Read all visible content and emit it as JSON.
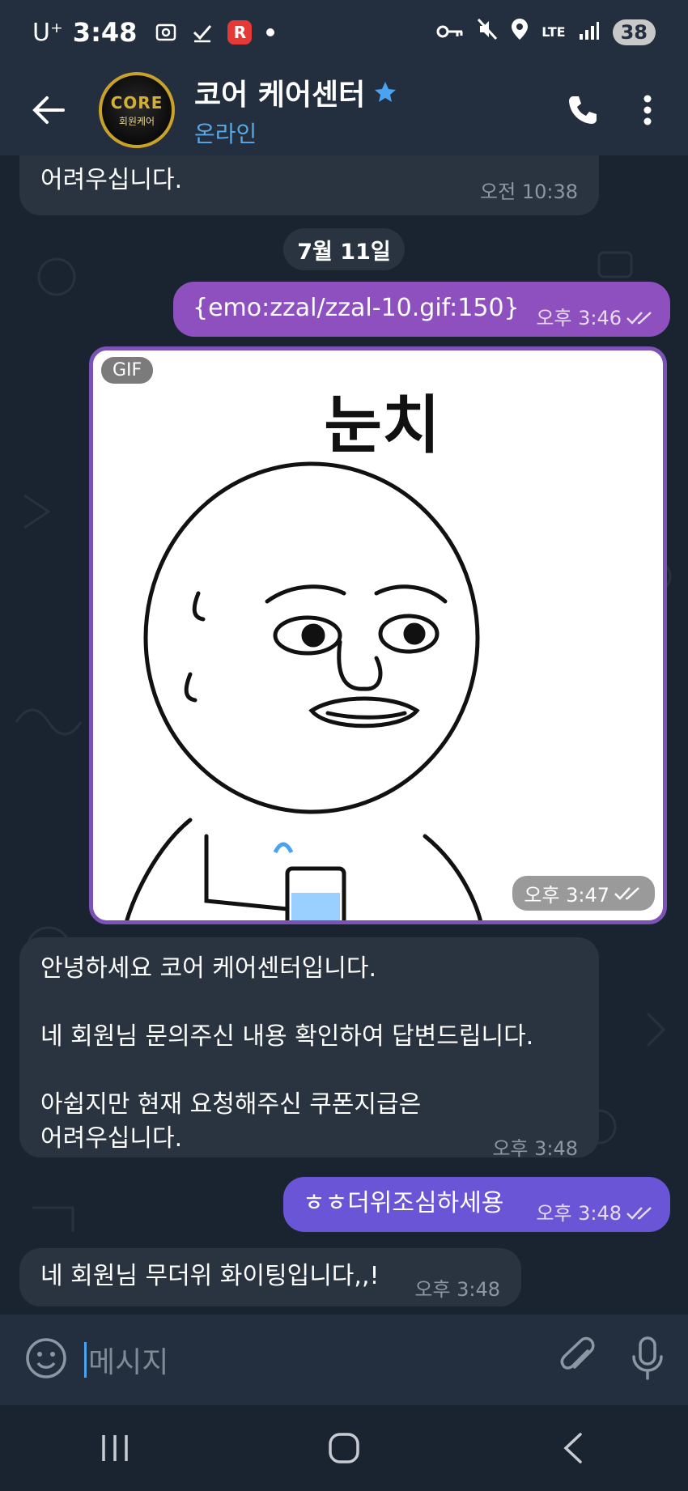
{
  "status_bar": {
    "carrier": "U⁺",
    "time": "3:48",
    "lte": "LTE",
    "battery": "38"
  },
  "header": {
    "avatar_logo": "CORE",
    "avatar_sub": "회원케어",
    "title": "코어 케어센터",
    "status": "온라인"
  },
  "messages": {
    "m1": {
      "text_line": "어려우십니다.",
      "time": "오전 10:38"
    },
    "date_divider": "7월 11일",
    "m2": {
      "text": "{emo:zzal/zzal-10.gif:150}",
      "time": "오후 3:46"
    },
    "gif": {
      "badge": "GIF",
      "caption": "눈치",
      "time": "오후 3:47"
    },
    "m3": {
      "line1": "안녕하세요 코어 케어센터입니다.",
      "line2": "네 회원님 문의주신 내용 확인하여 답변드립니다.",
      "line3": "아쉽지만 현재 요청해주신 쿠폰지급은",
      "line4": "어려우십니다.",
      "time": "오후 3:48"
    },
    "m4": {
      "text": "ㅎㅎ더위조심하세용",
      "time": "오후 3:48"
    },
    "m5": {
      "text": "네 회원님 무더위 화이팅입니다,,!",
      "time": "오후 3:48"
    }
  },
  "composer": {
    "placeholder": "메시지"
  },
  "colors": {
    "accent_blue": "#5aa7e6",
    "out_bubble_1": "#8e4fbf",
    "out_bubble_2": "#6a55d6",
    "bg": "#1a2431"
  }
}
